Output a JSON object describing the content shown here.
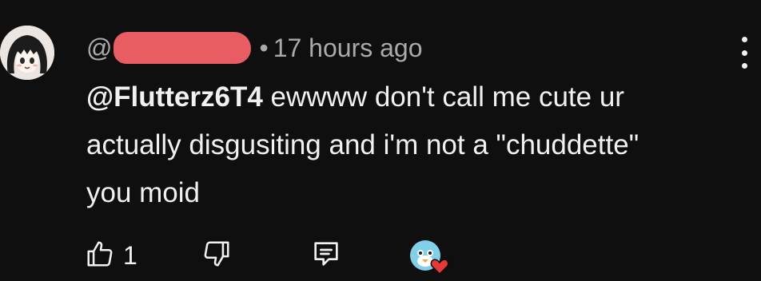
{
  "comment": {
    "author_prefix": "@",
    "author_redacted": true,
    "separator": "•",
    "timestamp": "17 hours ago",
    "mention": "@Flutterz6T4",
    "text_lines": [
      " ewwww don't call me cute ur",
      "actually disgusiting and i'm not a \"chuddette\"",
      "you moid"
    ]
  },
  "actions": {
    "like_count": "1",
    "icons": [
      "thumbs-up-icon",
      "thumbs-down-icon",
      "reply-icon",
      "creator-heart-icon",
      "more-vertical-icon"
    ]
  },
  "colors": {
    "background": "#0f0f0f",
    "text": "#f1f1f1",
    "secondary_text": "#aaaaaa",
    "redaction": "#e85d63",
    "heart": "#e53935"
  }
}
